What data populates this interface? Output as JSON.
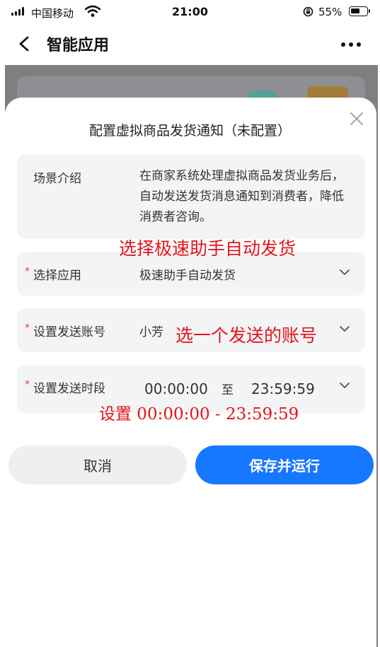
{
  "status_bar": {
    "carrier": "中国移动",
    "time": "21:00",
    "battery": "55%"
  },
  "nav": {
    "title": "智能应用"
  },
  "dialog": {
    "title": "配置虚拟商品发货通知（未配置）",
    "intro": {
      "label": "场景介绍",
      "text": "在商家系统处理虚拟商品发货业务后，自动发送发货消息通知到消费者，降低消费者咨询。"
    },
    "fields": {
      "app": {
        "label": "选择应用",
        "value": "极速助手自动发货"
      },
      "account": {
        "label": "设置发送账号",
        "value": "小芳"
      },
      "time": {
        "label": "设置发送时段",
        "start": "00:00:00",
        "separator": "至",
        "end": "23:59:59"
      }
    },
    "required_mark": "*",
    "buttons": {
      "cancel": "取消",
      "save": "保存并运行"
    }
  },
  "annotations": {
    "app": "选择极速助手自动发货",
    "account": "选一个发送的账号",
    "time": "设置 00:00:00 - 23:59:59"
  },
  "colors": {
    "primary": "#1677ff",
    "annotation": "#e4141b",
    "required": "#e53935"
  }
}
